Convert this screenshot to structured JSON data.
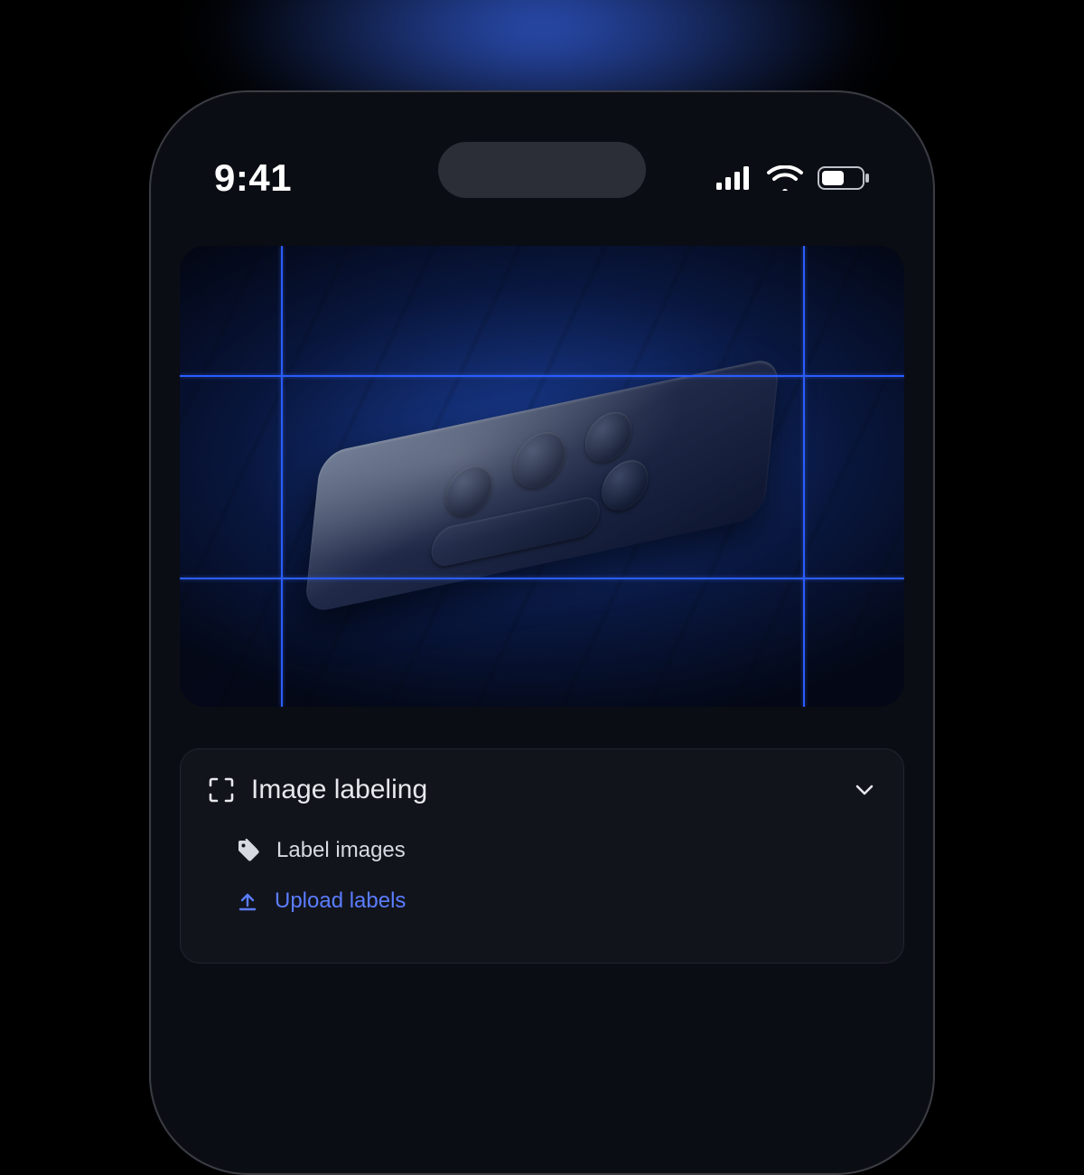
{
  "statusbar": {
    "time": "9:41"
  },
  "panel": {
    "title": "Image labeling",
    "items": [
      {
        "icon": "tag-icon",
        "label": "Label images",
        "link": false
      },
      {
        "icon": "upload-icon",
        "label": "Upload labels",
        "link": true
      }
    ]
  }
}
